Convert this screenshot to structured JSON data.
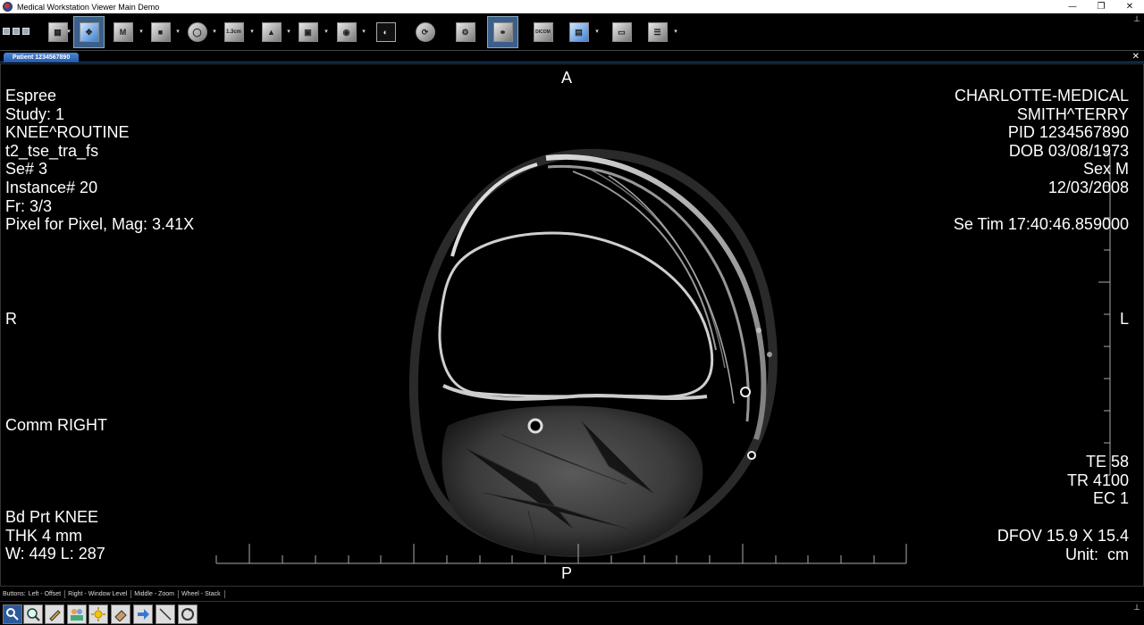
{
  "window": {
    "title": "Medical Workstation Viewer Main Demo",
    "minimize_glyph": "—",
    "restore_glyph": "❐",
    "close_glyph": "✕"
  },
  "toolbar": {
    "pin_glyph": "⊥",
    "dropdown_glyph": "▾",
    "buttons": [
      {
        "name": "layout",
        "icon": "layout-grid-icon",
        "glyph": "▦"
      },
      {
        "name": "pan",
        "icon": "pan-move-icon",
        "glyph": "✥"
      },
      {
        "name": "magnify",
        "icon": "magnify-icon",
        "glyph": "M"
      },
      {
        "name": "window-level",
        "icon": "window-level-icon",
        "glyph": "■"
      },
      {
        "name": "roi",
        "icon": "roi-shape-icon",
        "glyph": "◯"
      },
      {
        "name": "measure",
        "icon": "ruler-icon",
        "glyph": "1.3cm"
      },
      {
        "name": "angle",
        "icon": "angle-icon",
        "glyph": "▲"
      },
      {
        "name": "tile",
        "icon": "tile-icon",
        "glyph": "▣"
      },
      {
        "name": "overlay",
        "icon": "overlay-icon",
        "glyph": "◉"
      },
      {
        "name": "invert",
        "icon": "invert-icon",
        "glyph": "◐"
      },
      {
        "name": "rotate",
        "icon": "rotate-icon",
        "glyph": "⟳"
      },
      {
        "name": "settings",
        "icon": "settings-icon",
        "glyph": "⚙"
      },
      {
        "name": "link",
        "icon": "link-icon",
        "glyph": "⚭"
      },
      {
        "name": "dicom",
        "icon": "dicom-info-icon",
        "glyph": "DICOM"
      },
      {
        "name": "series-layout",
        "icon": "series-layout-icon",
        "glyph": "▤"
      },
      {
        "name": "film",
        "icon": "film-icon",
        "glyph": "▭"
      },
      {
        "name": "report",
        "icon": "report-icon",
        "glyph": "☰"
      }
    ]
  },
  "tabs": [
    {
      "label": "Patient 1234567890"
    }
  ],
  "tab_close_glyph": "✕",
  "overlay": {
    "top_left": [
      "Espree",
      "Study: 1",
      "KNEE^ROUTINE",
      "t2_tse_tra_fs",
      "Se# 3",
      "Instance# 20",
      "Fr: 3/3",
      "Pixel for Pixel, Mag: 3.41X"
    ],
    "top_right": [
      "CHARLOTTE-MEDICAL",
      "SMITH^TERRY",
      "PID 1234567890",
      "DOB 03/08/1973",
      "Sex M",
      "12/03/2008",
      "",
      "Se Tim 17:40:46.859000"
    ],
    "left_mid": "Comm RIGHT",
    "bottom_left": [
      "Bd Prt KNEE",
      "THK 4 mm",
      "W: 449 L: 287"
    ],
    "right_mid": [
      "TE 58",
      "TR 4100",
      "EC 1"
    ],
    "bottom_right": [
      "DFOV 15.9 X 15.4",
      "Unit:  cm"
    ],
    "orientation": {
      "top": "A",
      "bottom": "P",
      "left": "R",
      "right": "L"
    }
  },
  "status": {
    "items": [
      "Buttons:",
      "Left - Offset",
      "Right - Window Level",
      "Middle - Zoom",
      "Wheel - Stack"
    ]
  },
  "bottom_toolbar": {
    "pin_glyph": "⊥",
    "buttons": [
      {
        "name": "patient-search",
        "icon": "patient-search-icon"
      },
      {
        "name": "zoom",
        "icon": "zoom-icon"
      },
      {
        "name": "annotate",
        "icon": "pencil-icon"
      },
      {
        "name": "users",
        "icon": "users-icon"
      },
      {
        "name": "sun",
        "icon": "brightness-icon"
      },
      {
        "name": "eraser",
        "icon": "eraser-icon"
      },
      {
        "name": "next",
        "icon": "next-arrow-icon"
      },
      {
        "name": "line",
        "icon": "line-tool-icon"
      },
      {
        "name": "reset",
        "icon": "reset-icon"
      }
    ]
  }
}
